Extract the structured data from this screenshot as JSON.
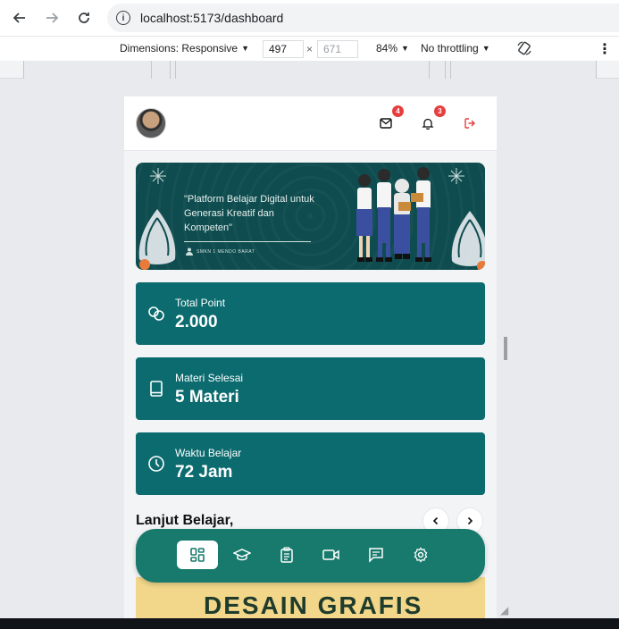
{
  "browser": {
    "url": "localhost:5173/dashboard"
  },
  "devtools": {
    "dimensions_label": "Dimensions: Responsive",
    "width_value": "497",
    "height_placeholder": "671",
    "times": "×",
    "zoom": "84%",
    "throttling": "No throttling"
  },
  "header": {
    "mail_badge": "4",
    "notif_badge": "3"
  },
  "banner": {
    "quote": "\"Platform Belajar Digital untuk Generasi Kreatif dan Kompeten\"",
    "school": "SMKN 1 MENDO BARAT"
  },
  "stats": [
    {
      "label": "Total Point",
      "value": "2.000",
      "icon": "coins-icon"
    },
    {
      "label": "Materi Selesai",
      "value": "5 Materi",
      "icon": "book-icon"
    },
    {
      "label": "Waktu Belajar",
      "value": "72 Jam",
      "icon": "clock-icon"
    }
  ],
  "section": {
    "title": "Lanjut Belajar,"
  },
  "course_peek": {
    "text": "DESAIN GRAFIS"
  },
  "bottom_nav": {
    "items": [
      "dashboard-icon",
      "graduation-cap-icon",
      "clipboard-icon",
      "video-icon",
      "chat-icon",
      "settings-icon"
    ],
    "active_index": 0
  },
  "colors": {
    "primary": "#0b6b6f",
    "nav": "#177a6c",
    "badge": "#e53e3e",
    "banner": "#0f4c4f"
  }
}
